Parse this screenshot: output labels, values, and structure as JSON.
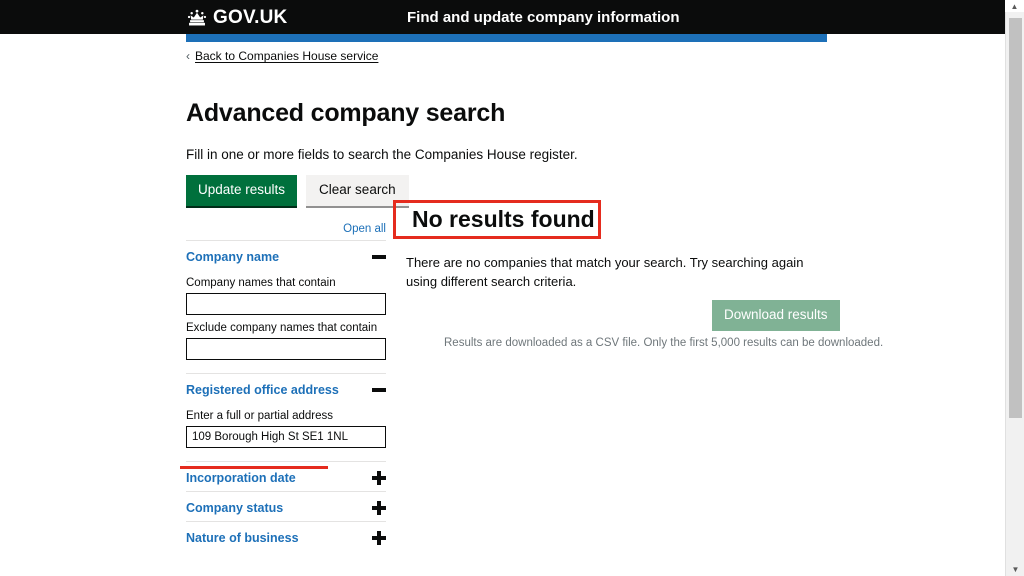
{
  "header": {
    "logo_text": "GOV.UK",
    "crown_icon": "crown-icon",
    "service_name": "Find and update company information"
  },
  "back_link": {
    "chevron": "‹",
    "label": "Back to Companies House service"
  },
  "main": {
    "title": "Advanced company search",
    "intro": "Fill in one or more fields to search the Companies House register.",
    "update_button": "Update results",
    "clear_button": "Clear search"
  },
  "filters": {
    "open_all": "Open all",
    "sections": [
      {
        "title": "Company name",
        "state": "expanded",
        "toggle_icon": "minus-icon",
        "fields": [
          {
            "label": "Company names that contain",
            "value": "",
            "placeholder": ""
          },
          {
            "label": "Exclude company names that contain",
            "value": "",
            "placeholder": ""
          }
        ]
      },
      {
        "title": "Registered office address",
        "state": "expanded",
        "toggle_icon": "minus-icon",
        "fields": [
          {
            "label": "Enter a full or partial address",
            "value": "109 Borough High St SE1 1NL",
            "placeholder": ""
          }
        ]
      },
      {
        "title": "Incorporation date",
        "state": "collapsed",
        "toggle_icon": "plus-icon",
        "fields": []
      },
      {
        "title": "Company status",
        "state": "collapsed",
        "toggle_icon": "plus-icon",
        "fields": []
      },
      {
        "title": "Nature of business",
        "state": "collapsed",
        "toggle_icon": "plus-icon",
        "fields": []
      }
    ]
  },
  "results": {
    "heading": "No results found",
    "message": "There are no companies that match your search. Try searching again using different search criteria.",
    "download_button": "Download results",
    "download_note": "Results are downloaded as a CSV file. Only the first 5,000 results can be downloaded."
  },
  "annotations": {
    "highlight_box_target": "no-results-heading",
    "underline_target": "registered-office-address",
    "color": "#e52b1e"
  },
  "colors": {
    "header_black": "#0b0c0c",
    "service_blue": "#1d70b8",
    "link_blue": "#1d70b8",
    "button_green": "#00703c",
    "button_grey": "#f3f2f1",
    "download_green_disabled": "#80b295",
    "annotation_red": "#e52b1e"
  },
  "scrollbar": {
    "icon": "scrollbar"
  }
}
